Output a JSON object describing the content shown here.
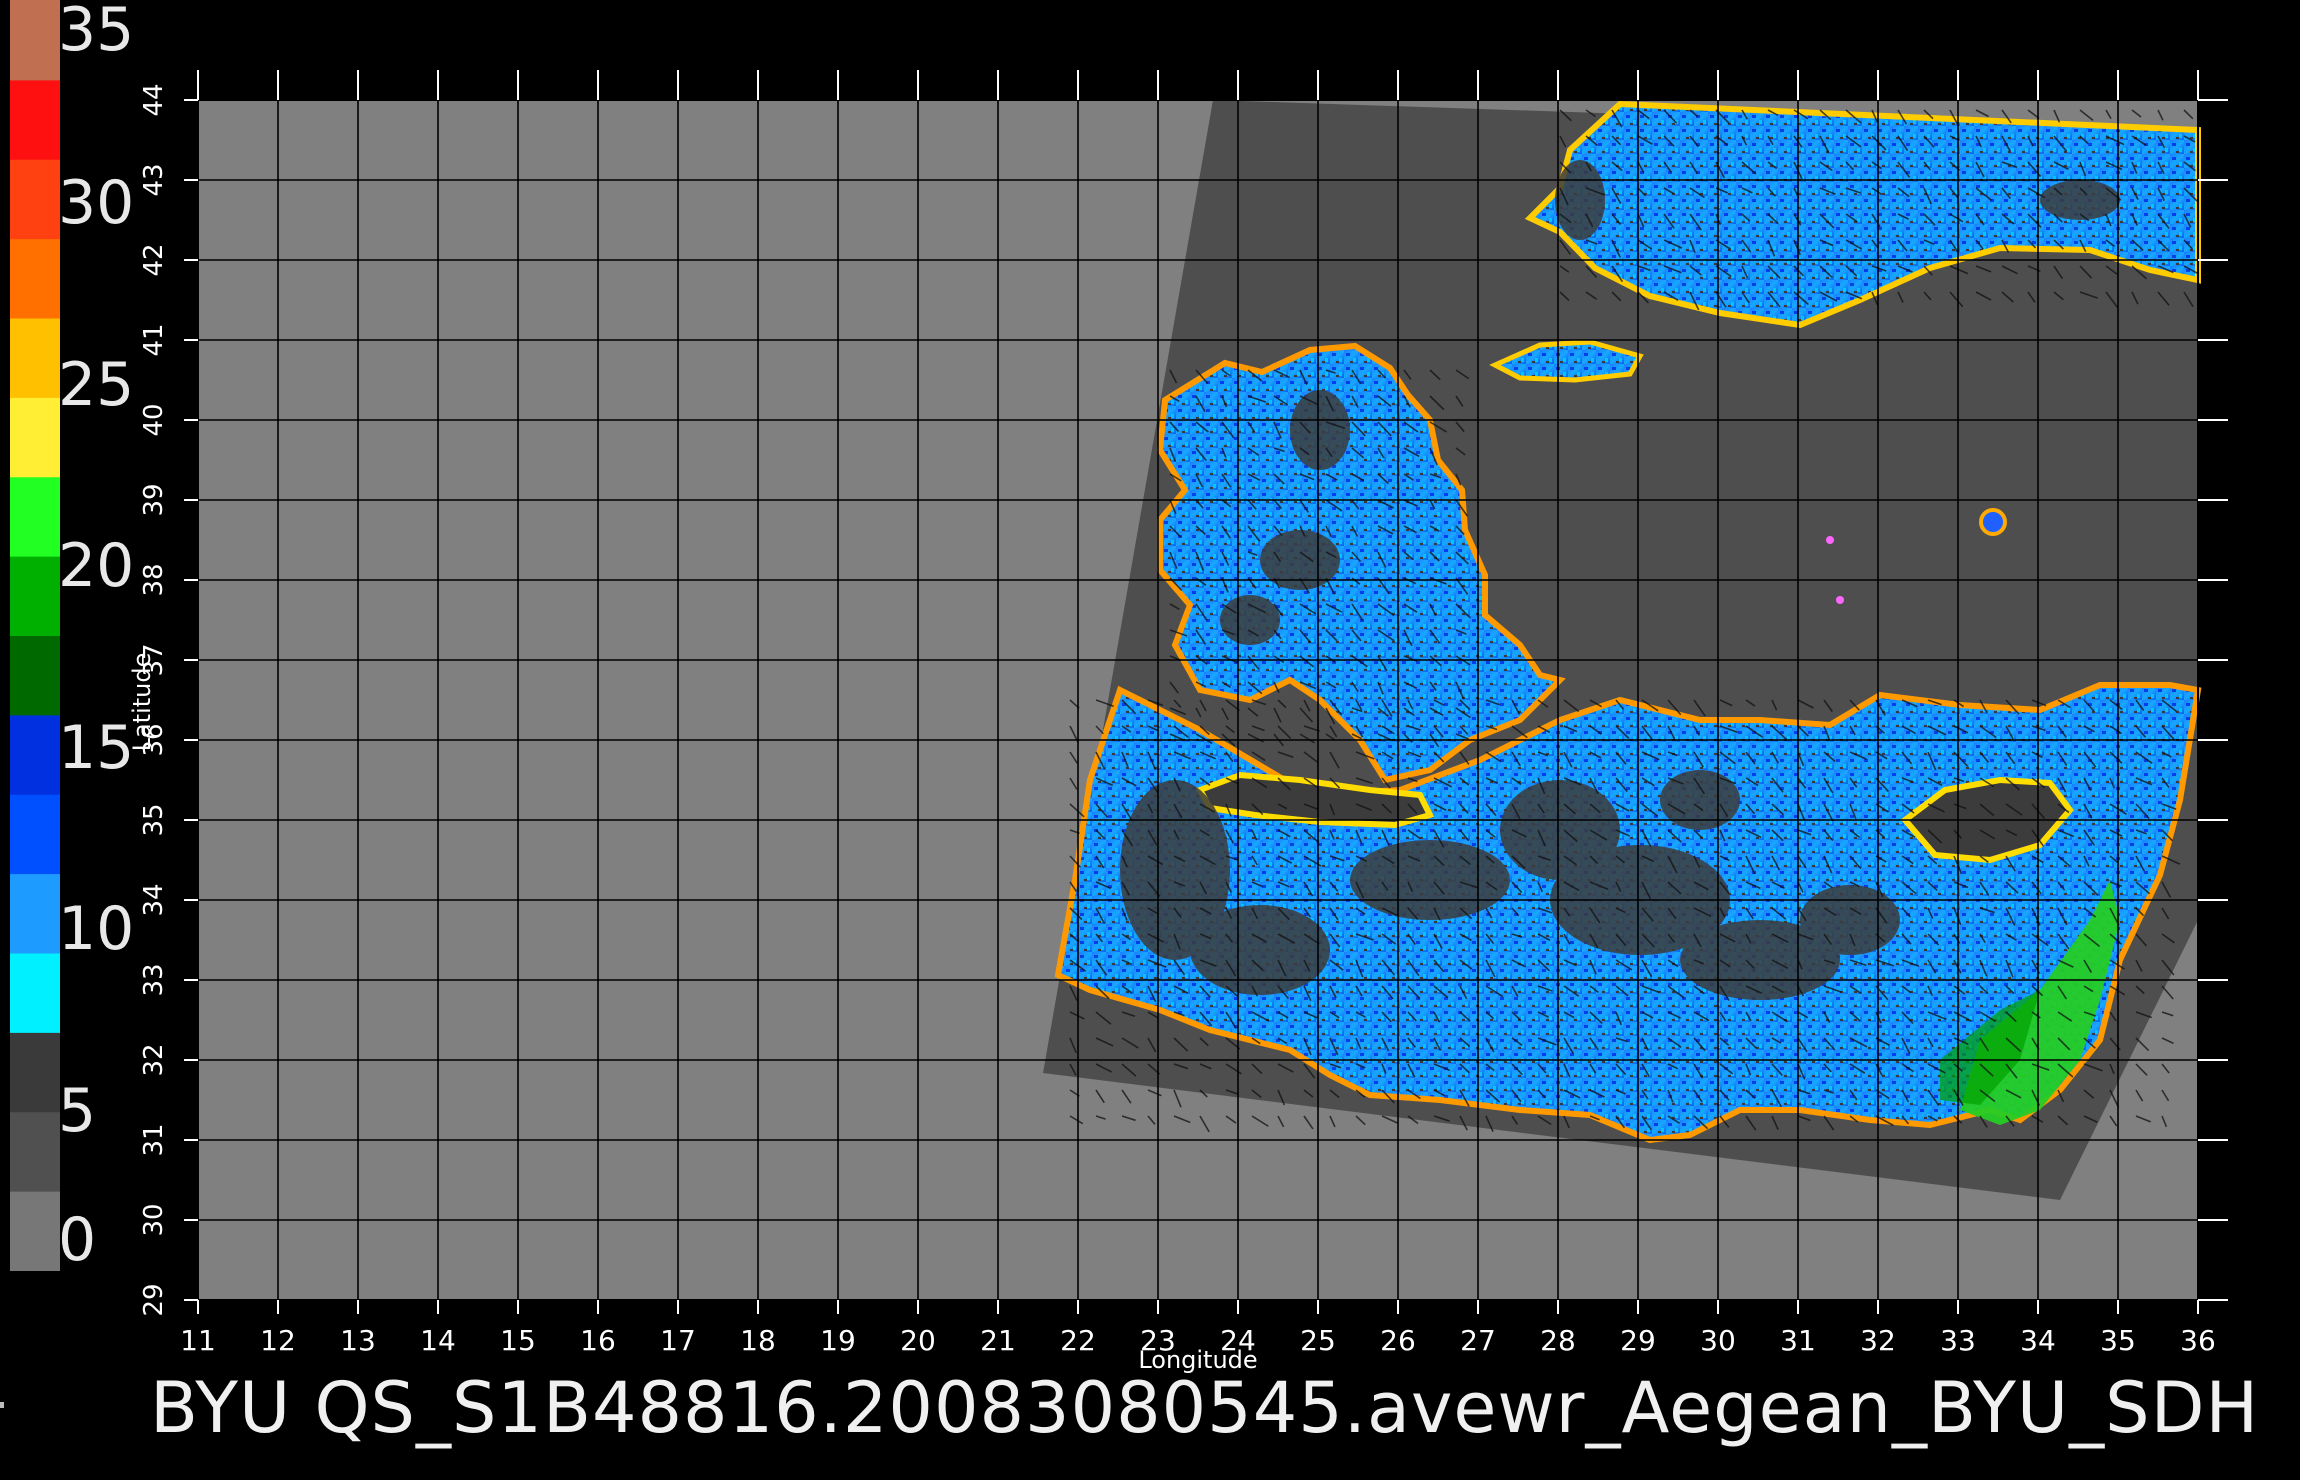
{
  "title": "BYU  QS_S1B48816.20083080545.avewr_Aegean_BYU_SDH",
  "colorbar": {
    "ticks": [
      "35",
      "30",
      "25",
      "20",
      "15",
      "10",
      "5",
      "0"
    ],
    "colors": [
      "#777777",
      "#505050",
      "#3a3a3a",
      "#00f0ff",
      "#1e9bff",
      "#0050ff",
      "#0030e0",
      "#006a00",
      "#00b000",
      "#22ff22",
      "#ffee33",
      "#ffc000",
      "#ff7000",
      "#ff4010",
      "#ff1010",
      "#c07050"
    ]
  },
  "map": {
    "x_axis_label": "Longitude",
    "y_axis_label": "Latitude",
    "lon_ticks": [
      "11",
      "12",
      "13",
      "14",
      "15",
      "16",
      "17",
      "18",
      "19",
      "20",
      "21",
      "22",
      "23",
      "24",
      "25",
      "26",
      "27",
      "28",
      "29",
      "30",
      "31",
      "32",
      "33",
      "34",
      "35",
      "36"
    ],
    "lat_ticks": [
      "29",
      "30",
      "31",
      "32",
      "33",
      "34",
      "35",
      "36",
      "37",
      "38",
      "39",
      "40",
      "41",
      "42",
      "43",
      "44"
    ],
    "lon_range": [
      11,
      36
    ],
    "lat_range": [
      29,
      44
    ],
    "background_color": "#808080",
    "swath_color": "#4e4e4e",
    "land_mask_color": "#3c3c3c",
    "grid_color": "#000000"
  }
}
